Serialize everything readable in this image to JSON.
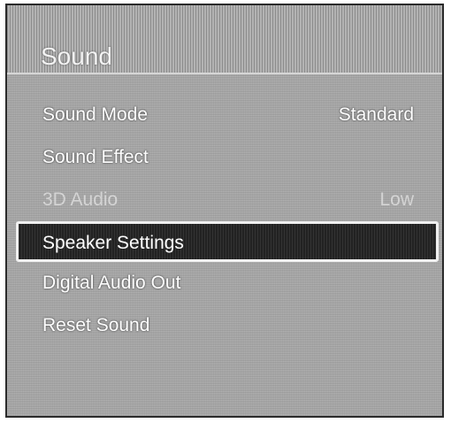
{
  "title": "Sound",
  "menu": [
    {
      "label": "Sound Mode",
      "value": "Standard",
      "state": "normal"
    },
    {
      "label": "Sound Effect",
      "value": "",
      "state": "normal"
    },
    {
      "label": "3D Audio",
      "value": "Low",
      "state": "disabled"
    },
    {
      "label": "Speaker Settings",
      "value": "",
      "state": "selected"
    },
    {
      "label": "Digital Audio Out",
      "value": "",
      "state": "normal"
    },
    {
      "label": "Reset Sound",
      "value": "",
      "state": "normal"
    }
  ]
}
